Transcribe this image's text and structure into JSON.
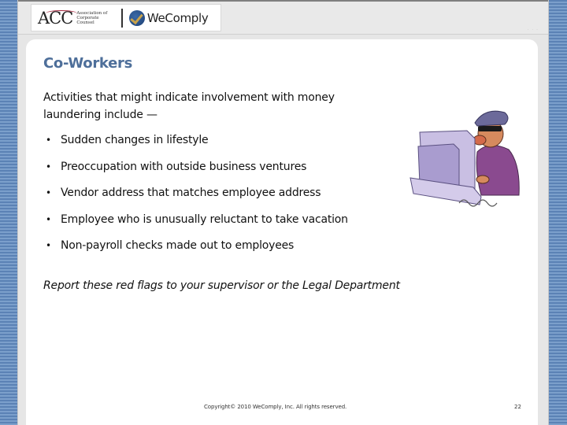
{
  "header": {
    "acc_logo": {
      "text": "ACC",
      "subtitle": "Association of Corporate Counsel"
    },
    "wecomply_logo": {
      "text": "WeComply",
      "icon": "checkmark-globe-icon"
    },
    "dots": "· · ·"
  },
  "slide": {
    "title": "Co-Workers",
    "intro": "Activities that might indicate involvement with money laundering include —",
    "bullets": [
      {
        "text": "Sudden changes in lifestyle"
      },
      {
        "text": "Preoccupation with outside business ventures"
      },
      {
        "text": "Vendor address that matches employee address"
      },
      {
        "text": "Employee who is unusually reluctant to take vacation"
      },
      {
        "text": "Non-payroll checks made out to employees"
      }
    ],
    "bullet_glyph": "•",
    "callout": "Report these red flags to your supervisor or the Legal Department",
    "illustration": "masked-burglar-at-computer"
  },
  "footer": {
    "copyright": "Copyright© 2010 WeComply, Inc. All rights reserved.",
    "page_number": "22"
  },
  "colors": {
    "title": "#4e6f9a",
    "side_stripe_dark": "#5b82b5",
    "side_stripe_light": "#7b9fcb",
    "frame": "#e6e6e6",
    "content_bg": "#ffffff"
  }
}
